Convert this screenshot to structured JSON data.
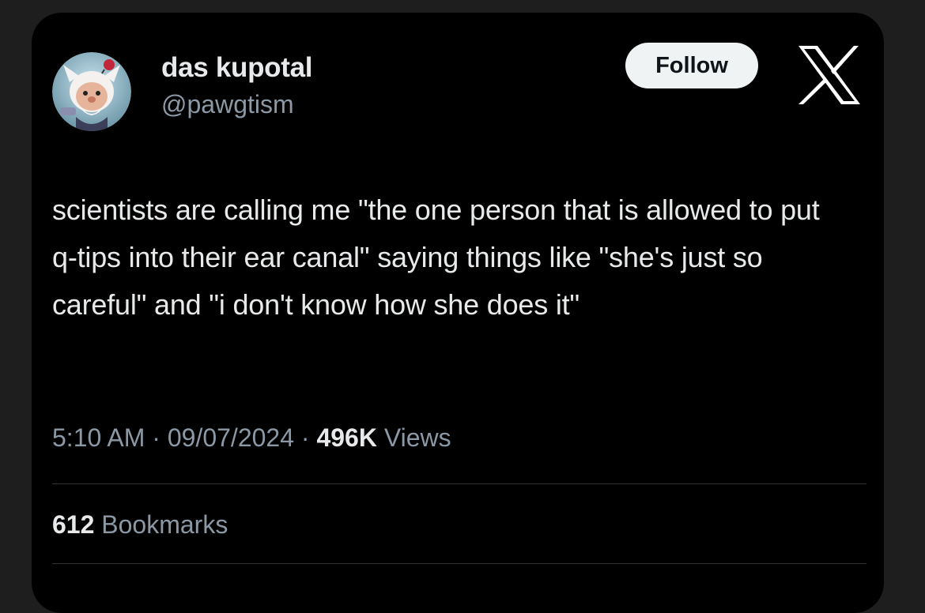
{
  "user": {
    "display_name": "das kupotal",
    "handle": "@pawgtism"
  },
  "header": {
    "follow_label": "Follow",
    "logo_icon": "x-logo-icon"
  },
  "tweet": {
    "text": "scientists are calling me \"the one person that is allowed to put q-tips into their ear canal\" saying things like \"she's just so careful\" and \"i don't know how she does it\"",
    "time": "5:10 AM",
    "date": "09/07/2024",
    "views_count": "496K",
    "views_label": "Views",
    "separator": "·"
  },
  "stats": {
    "bookmarks_count": "612",
    "bookmarks_label": "Bookmarks"
  },
  "colors": {
    "background": "#000000",
    "primary_text": "#e7e9ea",
    "secondary_text": "#8b98a5",
    "follow_button_bg": "#eff3f4",
    "divider": "#2f3336"
  }
}
